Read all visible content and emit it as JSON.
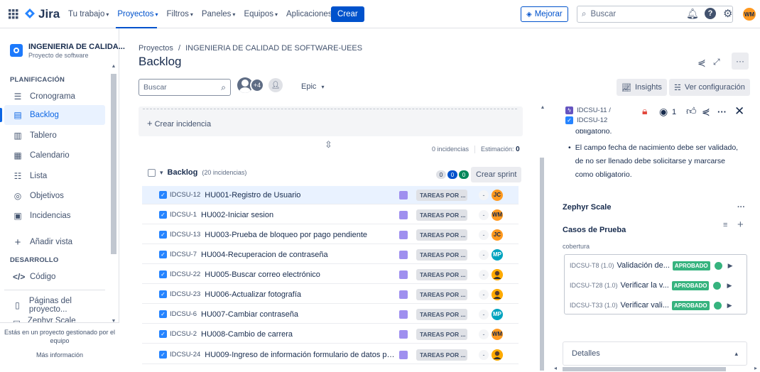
{
  "topnav": {
    "logo": "Jira",
    "items": [
      {
        "label": "Tu trabajo",
        "active": false
      },
      {
        "label": "Proyectos",
        "active": true
      },
      {
        "label": "Filtros",
        "active": false
      },
      {
        "label": "Paneles",
        "active": false
      },
      {
        "label": "Equipos",
        "active": false
      },
      {
        "label": "Aplicaciones",
        "active": false
      }
    ],
    "create_label": "Crear",
    "upgrade_label": "Mejorar",
    "search_placeholder": "Buscar",
    "user_initials": "WM"
  },
  "sidebar": {
    "project_name": "INGENIERIA DE CALIDA...",
    "project_type": "Proyecto de software",
    "planning_heading": "PLANIFICACIÓN",
    "planning_items": [
      {
        "label": "Cronograma",
        "icon": "timeline-icon"
      },
      {
        "label": "Backlog",
        "icon": "backlog-icon",
        "active": true
      },
      {
        "label": "Tablero",
        "icon": "board-icon"
      },
      {
        "label": "Calendario",
        "icon": "calendar-icon"
      },
      {
        "label": "Lista",
        "icon": "list-icon"
      },
      {
        "label": "Objetivos",
        "icon": "goals-icon"
      },
      {
        "label": "Incidencias",
        "icon": "issues-icon"
      }
    ],
    "add_view_label": "Añadir vista",
    "dev_heading": "DESARROLLO",
    "code_label": "Código",
    "project_pages_label": "Páginas del proyecto...",
    "zephyr_label": "Zephyr Scale",
    "footer_text": "Estás en un proyecto gestionado por el equipo",
    "footer_link": "Más información"
  },
  "main": {
    "breadcrumb_root": "Proyectos",
    "breadcrumb_sep": "/",
    "breadcrumb_project": "INGENIERIA DE CALIDAD DE SOFTWARE-UEES",
    "title": "Backlog",
    "search_placeholder": "Buscar",
    "avatar_more": "+4",
    "epic_filter": "Epic",
    "insights_label": "Insights",
    "view_settings_label": "Ver configuración",
    "create_issue_label": "Crear incidencia",
    "sprint_footer": {
      "issues": "0 incidencias",
      "estimate_label": "Estimación:",
      "estimate_value": "0"
    },
    "backlog_section": {
      "title": "Backlog",
      "count": "(20 incidencias)",
      "counts": [
        "0",
        "0",
        "0"
      ],
      "create_sprint_label": "Crear sprint"
    },
    "issues": [
      {
        "key": "IDCSU-12",
        "summary": "HU001-Registro de Usuario",
        "status": "TAREAS POR ...",
        "est": "-",
        "assignee": "JC",
        "av_color": "#ff991f",
        "selected": true
      },
      {
        "key": "IDCSU-1",
        "summary": "HU002-Iniciar sesion",
        "status": "TAREAS POR ...",
        "est": "-",
        "assignee": "WM",
        "av_color": "#ff991f"
      },
      {
        "key": "IDCSU-13",
        "summary": "HU003-Prueba de bloqueo por pago pendiente",
        "status": "TAREAS POR ...",
        "est": "-",
        "assignee": "JC",
        "av_color": "#ff991f"
      },
      {
        "key": "IDCSU-7",
        "summary": "HU004-Recuperacion de contraseña",
        "status": "TAREAS POR ...",
        "est": "-",
        "assignee": "MP",
        "av_color": "#00a3bf"
      },
      {
        "key": "IDCSU-22",
        "summary": "HU005-Buscar correo electrónico",
        "status": "TAREAS POR ...",
        "est": "-",
        "assignee": "",
        "av_color": "#ffab00"
      },
      {
        "key": "IDCSU-23",
        "summary": "HU006-Actualizar fotografía",
        "status": "TAREAS POR ...",
        "est": "-",
        "assignee": "",
        "av_color": "#ffab00"
      },
      {
        "key": "IDCSU-6",
        "summary": "HU007-Cambiar contraseña",
        "status": "TAREAS POR ...",
        "est": "-",
        "assignee": "MP",
        "av_color": "#00a3bf"
      },
      {
        "key": "IDCSU-2",
        "summary": "HU008-Cambio de carrera",
        "status": "TAREAS POR ...",
        "est": "-",
        "assignee": "WM",
        "av_color": "#ff991f"
      },
      {
        "key": "IDCSU-24",
        "summary": "HU009-Ingreso de información formulario de datos person...",
        "status": "TAREAS POR ...",
        "est": "-",
        "assignee": "",
        "av_color": "#ffab00"
      }
    ]
  },
  "detail": {
    "parent_key": "IDCSU-11 /",
    "issue_key": "IDCSU-12",
    "watch_count": "1",
    "desc_fragment": "obligatorio.",
    "desc_bullet": "El campo fecha de nacimiento debe ser validado, de no ser llenado debe solicitarse y marcarse como obligatorio.",
    "zephyr_title": "Zephyr Scale",
    "test_cases_title": "Casos de Prueba",
    "coverage_label": "cobertura",
    "test_cases": [
      {
        "key": "IDCSU-T8 (1.0)",
        "name": "Validación de...",
        "status": "APROBADO"
      },
      {
        "key": "IDCSU-T28 (1.0)",
        "name": "Verificar la v...",
        "status": "APROBADO"
      },
      {
        "key": "IDCSU-T33 (1.0)",
        "name": "Verificar vali...",
        "status": "APROBADO"
      }
    ],
    "details_label": "Detalles"
  }
}
